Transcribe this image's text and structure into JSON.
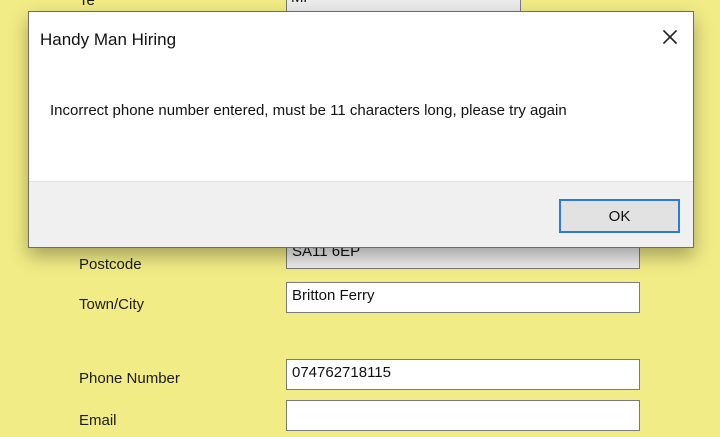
{
  "background_form": {
    "top_partial_label": "Te",
    "top_partial_field": "Mr",
    "postcode_label": "Postcode",
    "postcode_value": "SA11 6EP",
    "town_label": "Town/City",
    "town_value": "Britton Ferry",
    "phone_label": "Phone Number",
    "phone_value": "074762718115",
    "email_label": "Email",
    "email_value": ""
  },
  "dialog": {
    "title": "Handy Man Hiring",
    "message": "Incorrect phone number entered, must be 11 characters long, please try again",
    "ok_label": "OK",
    "close_icon": "close-icon"
  },
  "colors": {
    "form_background": "#f2ec86",
    "dialog_background": "#ffffff",
    "dialog_footer": "#f0f0f0",
    "button_focus": "#2f7ad8"
  }
}
